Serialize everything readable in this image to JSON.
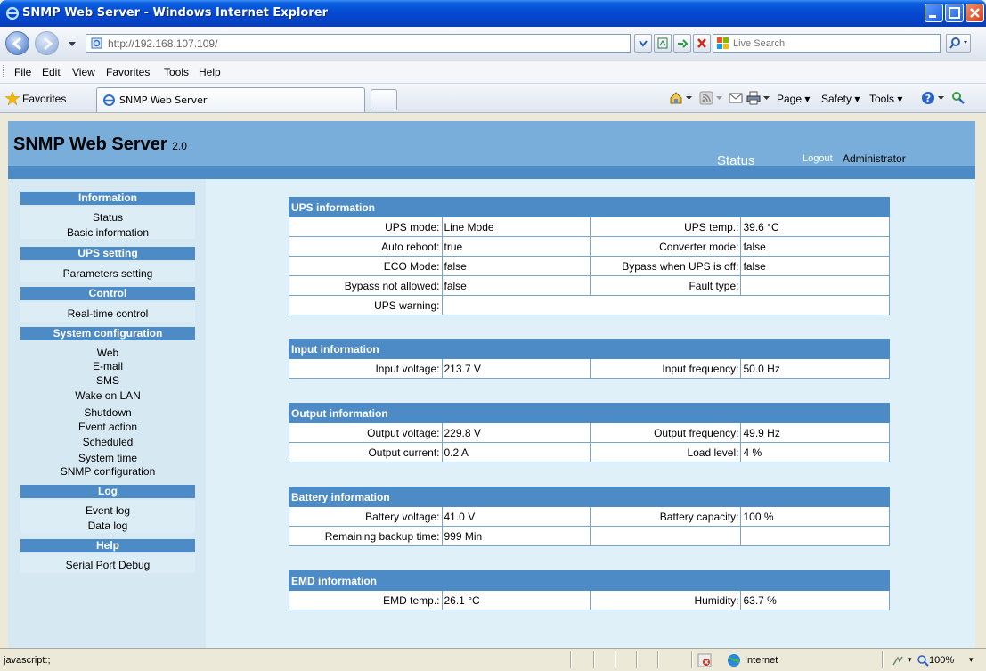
{
  "window": {
    "title": "SNMP Web Server - Windows Internet Explorer",
    "accent": "#0548d0"
  },
  "address_bar": {
    "url": "http://192.168.107.109/",
    "search_placeholder": "Live Search"
  },
  "menu": [
    "File",
    "Edit",
    "View",
    "Favorites",
    "Tools",
    "Help"
  ],
  "favorites_bar": {
    "favorites_label": "Favorites",
    "tab_label": "SNMP Web Server",
    "commands": {
      "page": "Page",
      "safety": "Safety",
      "tools": "Tools"
    }
  },
  "header": {
    "brand": "SNMP Web Server",
    "version": "2.0",
    "active_tab": "Status",
    "logout": "Logout",
    "user": "Administrator",
    "colors": {
      "header": "#7aaeda",
      "strip": "#4d8bc7"
    }
  },
  "sidebar": {
    "information": {
      "title": "Information",
      "items": [
        "Status",
        "Basic information"
      ]
    },
    "ups_setting": {
      "title": "UPS setting",
      "items": [
        "Parameters setting"
      ]
    },
    "control": {
      "title": "Control",
      "items": [
        "Real-time control"
      ]
    },
    "system_configuration": {
      "title": "System configuration",
      "items": [
        "Web",
        "E-mail",
        "SMS",
        "Wake on LAN",
        "Shutdown",
        "Event action",
        "Scheduled",
        "System time",
        "SNMP configuration"
      ]
    },
    "log": {
      "title": "Log",
      "items": [
        "Event log",
        "Data log"
      ]
    },
    "help": {
      "title": "Help",
      "items": [
        "Serial Port Debug"
      ]
    }
  },
  "ups_information": {
    "title": "UPS information",
    "rows": [
      {
        "label1": "UPS mode:",
        "value1": "Line Mode",
        "label2": "UPS temp.:",
        "value2": "39.6 °C"
      },
      {
        "label1": "Auto reboot:",
        "value1": "true",
        "label2": "Converter mode:",
        "value2": "false"
      },
      {
        "label1": "ECO Mode:",
        "value1": "false",
        "label2": "Bypass when UPS is off:",
        "value2": "false"
      },
      {
        "label1": "Bypass not allowed:",
        "value1": "false",
        "label2": "Fault type:",
        "value2": ""
      }
    ],
    "warning_label": "UPS warning:",
    "warning_value": ""
  },
  "input_information": {
    "title": "Input information",
    "rows": [
      {
        "label1": "Input voltage:",
        "value1": "213.7 V",
        "label2": "Input frequency:",
        "value2": "50.0 Hz"
      }
    ]
  },
  "output_information": {
    "title": "Output information",
    "rows": [
      {
        "label1": "Output voltage:",
        "value1": "229.8 V",
        "label2": "Output frequency:",
        "value2": "49.9 Hz"
      },
      {
        "label1": "Output current:",
        "value1": "0.2 A",
        "label2": "Load level:",
        "value2": "4 %"
      }
    ]
  },
  "battery_information": {
    "title": "Battery information",
    "rows": [
      {
        "label1": "Battery voltage:",
        "value1": "41.0 V",
        "label2": "Battery capacity:",
        "value2": "100 %"
      },
      {
        "label1": "Remaining backup time:",
        "value1": "999 Min",
        "label2": "",
        "value2": ""
      }
    ]
  },
  "emd_information": {
    "title": "EMD information",
    "rows": [
      {
        "label1": "EMD temp.:",
        "value1": "26.1 °C",
        "label2": "Humidity:",
        "value2": "63.7 %"
      }
    ]
  },
  "status_bar": {
    "text": "javascript:;",
    "zone": "Internet",
    "zoom": "100%"
  }
}
